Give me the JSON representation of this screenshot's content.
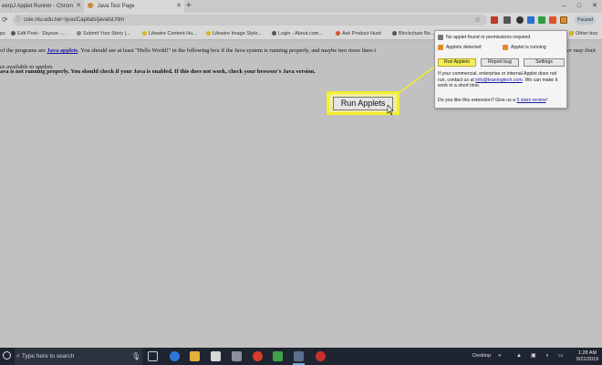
{
  "browser": {
    "tabs": [
      {
        "title": "eerpJ Applet Runner - Chrom",
        "active": false
      },
      {
        "title": "Java Test Page",
        "active": true
      }
    ],
    "new_tab": "+",
    "window_controls": {
      "minimize": "–",
      "maximize": "□",
      "close": "✕"
    },
    "url": "csie.ntu.edu.tw/~lyuu/Capitals/javatst.htm",
    "profile_label": "Paused",
    "bookmarks": [
      {
        "label": "ps",
        "color": "#4c8bf5"
      },
      {
        "label": "Edit Post - Skyose -...",
        "color": "#555555"
      },
      {
        "label": "Submit Your Story |...",
        "color": "#888888"
      },
      {
        "label": "Lifewire Content Hu...",
        "color": "#e0b021"
      },
      {
        "label": "Lifewire Image Style...",
        "color": "#e0b021"
      },
      {
        "label": "Login - About.com...",
        "color": "#555555"
      },
      {
        "label": "Ask Product Hunt",
        "color": "#d9542b"
      },
      {
        "label": "Blockchain Be...",
        "color": "#555555"
      },
      {
        "label": "Other boo",
        "color": "#e0b021"
      }
    ]
  },
  "page": {
    "line1_prefix": "of the programs are",
    "line1_link": "Java applets",
    "line1_suffix": ". You should see at least \"Hello World!\" in the following box if the Java system is running properly, and maybe two more lines i",
    "line1_right": "er may limit",
    "line2": "es available to applets.",
    "warning": "ava is not running properly. You should check if your Java is enabled. If this does not work, check your browser's Java version.",
    "run_applets_label": "Run Applets"
  },
  "extension_popup": {
    "status_1": "No applet found or permissions required",
    "status_2": "Applets detected",
    "status_3": "Applet is running",
    "buttons": {
      "run": "Run Applets",
      "report": "Report bug",
      "settings": "Settings"
    },
    "info_prefix": "If your commercial, enterprise or internal Applet does not run, contact us at",
    "info_email": "info@leaningtech.com",
    "info_suffix": ". We can make it work in a short time.",
    "ask_prefix": "Do you like this extension? Give us a",
    "ask_link": "5 stars review",
    "ask_suffix": "!"
  },
  "taskbar": {
    "search_placeholder": "Type here to search",
    "desktop_label": "Desktop",
    "time": "1:28 AM",
    "date": "9/21/2019"
  },
  "colors": {
    "highlight": "#f4ee2e",
    "link": "#1a1aa0",
    "extension_orange": "#e08a2a"
  }
}
